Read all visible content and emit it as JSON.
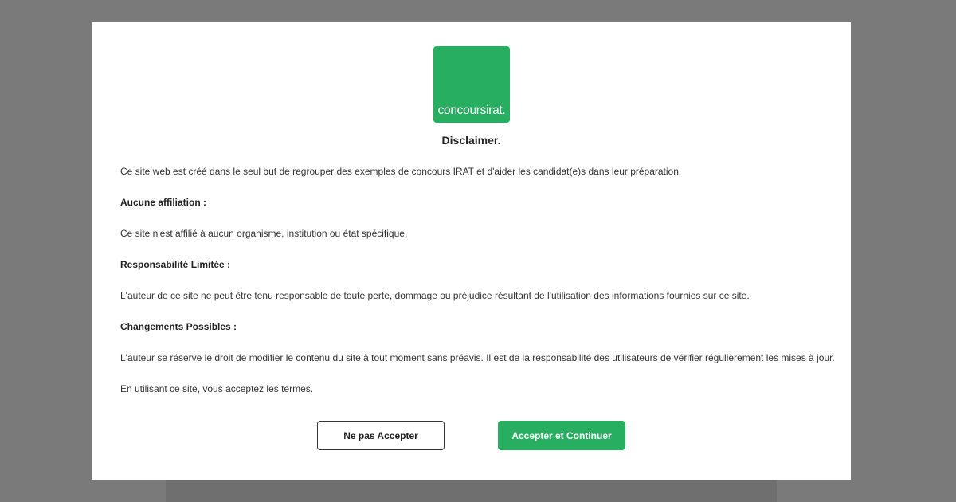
{
  "logo": {
    "text": "concoursirat.",
    "color": "#27ae60"
  },
  "disclaimer": {
    "title": "Disclaimer.",
    "intro": "Ce site web est créé dans le seul but de regrouper des exemples de concours IRAT et d'aider les candidat(e)s dans leur préparation.",
    "sections": [
      {
        "heading": "Aucune affiliation :",
        "text": "Ce site n'est affilié à aucun organisme, institution ou état spécifique."
      },
      {
        "heading": "Responsabilité Limitée :",
        "text": "L'auteur de ce site ne peut être tenu responsable de toute perte, dommage ou préjudice résultant de l'utilisation des informations fournies sur ce site."
      },
      {
        "heading": "Changements Possibles :",
        "text": "L'auteur se réserve le droit de modifier le contenu du site à tout moment sans préavis. Il est de la responsabilité des utilisateurs de vérifier régulièrement les mises à jour."
      }
    ],
    "closing": "En utilisant ce site, vous acceptez les termes."
  },
  "buttons": {
    "decline_label": "Ne pas Accepter",
    "accept_label": "Accepter et Continuer"
  },
  "colors": {
    "overlay": "#7a7a7a",
    "accent": "#27ae60"
  }
}
